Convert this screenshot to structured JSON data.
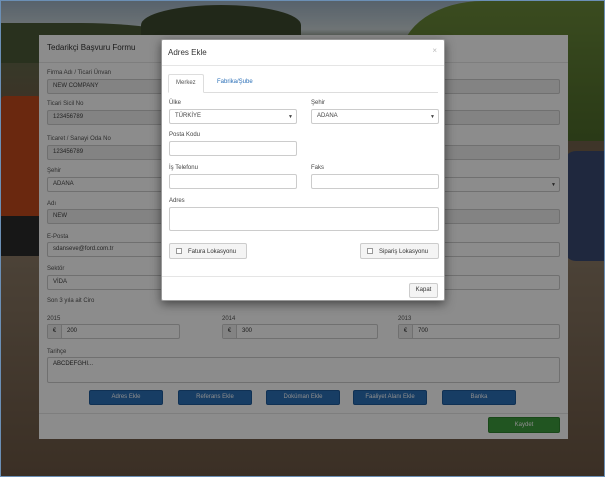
{
  "form": {
    "title": "Tedarikçi Başvuru Formu",
    "fields": {
      "company_label": "Firma Adı / Ticari Ünvan",
      "company_value": "NEW COMPANY",
      "trade_reg_label": "Ticari Sicil No",
      "trade_reg_value": "123456789",
      "chamber_label": "Ticaret / Sanayi Oda No",
      "chamber_value": "123456789",
      "city_label": "Şehir",
      "city_value": "ADANA",
      "name_label": "Adı",
      "name_value": "NEW",
      "email_label": "E-Posta",
      "email_value": "sdanseve@ford.com.tr",
      "sector_label": "Sektör",
      "sector_value": "VİDA",
      "revenue_label": "Son 3 yıla ait Ciro",
      "history_label": "Tarihçe",
      "history_value": "ABCDEFGHI..."
    },
    "revenue": [
      {
        "year": "2015",
        "currency": "€",
        "amount": "200"
      },
      {
        "year": "2014",
        "currency": "€",
        "amount": "300"
      },
      {
        "year": "2013",
        "currency": "€",
        "amount": "700"
      }
    ],
    "buttons": {
      "add_address": "Adres Ekle",
      "add_reference": "Referans Ekle",
      "add_document": "Doküman Ekle",
      "add_activity": "Faaliyet Alanı Ekle",
      "bank": "Banka",
      "save": "Kaydet"
    }
  },
  "modal": {
    "title": "Adres Ekle",
    "close_glyph": "×",
    "tabs": [
      "Merkez",
      "Fabrika/Şube"
    ],
    "country_label": "Ülke",
    "country_value": "TÜRKİYE",
    "city_label": "Şehir",
    "city_value": "ADANA",
    "postal_label": "Posta Kodu",
    "phone_label": "İş Telefonu",
    "fax_label": "Faks",
    "address_label": "Adres",
    "invoice_location": "Fatura Lokasyonu",
    "order_location": "Sipariş Lokasyonu",
    "close_button": "Kapat"
  },
  "colors": {
    "primary_button": "#2a6fb7",
    "save_button": "#3c9b3c",
    "link": "#2a6fb7"
  },
  "icons": {
    "dropdown": "caret-down-icon",
    "checkbox": "checkbox-icon",
    "close": "close-icon"
  }
}
